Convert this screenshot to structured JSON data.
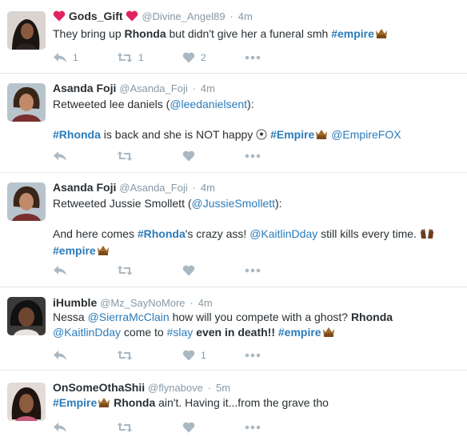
{
  "colors": {
    "link": "#2b7bb9",
    "heart": "#e0245e",
    "icon_gray": "#aab8c2",
    "meta_gray": "#8899a6",
    "text": "#292f33",
    "divider": "#e1e8ed"
  },
  "icons": {
    "reply": "reply-icon",
    "retweet": "retweet-icon",
    "like": "heart-icon",
    "more": "more-dots-icon",
    "crown": "crown-emoji-icon"
  },
  "tweets": [
    {
      "name": "Gods_Gift",
      "handle": "@Divine_Angel89",
      "dot": "·",
      "time": "4m",
      "text": {
        "t1": "They bring up ",
        "t2": "Rhonda",
        "t3": " but didn't give her a funeral smh ",
        "t4": "#empire"
      },
      "counts": {
        "reply": "1",
        "retweet": "1",
        "like": "2"
      }
    },
    {
      "name": "Asanda Foji",
      "handle": "@Asanda_Foji",
      "dot": "·",
      "time": "4m",
      "text": {
        "l1a": "Retweeted lee daniels (",
        "l1b": "@leedanielsent",
        "l1c": "):",
        "l2a": "#Rhonda",
        "l2b": " is back and she is NOT happy ",
        "l2c": "#Empire",
        "l2d": "@EmpireFOX"
      },
      "counts": {
        "reply": "",
        "retweet": "",
        "like": ""
      }
    },
    {
      "name": "Asanda Foji",
      "handle": "@Asanda_Foji",
      "dot": "·",
      "time": "4m",
      "text": {
        "l1a": "Retweeted Jussie Smollett (",
        "l1b": "@JussieSmollett",
        "l1c": "):",
        "l2a": "And here comes ",
        "l2b": "#Rhonda",
        "l2c": "'s crazy ass! ",
        "l2d": "@KaitlinDday",
        "l2e": " still kills every time. ",
        "l3a": "#empire"
      },
      "counts": {
        "reply": "",
        "retweet": "",
        "like": ""
      }
    },
    {
      "name": "iHumble",
      "handle": "@Mz_SayNoMore",
      "dot": "·",
      "time": "4m",
      "text": {
        "l1a": "Nessa ",
        "l1b": "@SierraMcClain",
        "l1c": "  how will you compete with a ghost? ",
        "l1d": "Rhonda",
        "l2a": "@KaitlinDday",
        "l2b": " come to ",
        "l2c": "#slay",
        "l2d": " even in death!! ",
        "l2e": "#empire"
      },
      "counts": {
        "reply": "",
        "retweet": "",
        "like": "1"
      }
    },
    {
      "name": "OnSomeOthaShii",
      "handle": "@flynabove",
      "dot": "·",
      "time": "5m",
      "text": {
        "l1a": "#Empire",
        "l1b": " Rhonda",
        "l1c": " ain't. Having it...from the grave tho"
      },
      "counts": {
        "reply": "",
        "retweet": "",
        "like": ""
      }
    }
  ]
}
